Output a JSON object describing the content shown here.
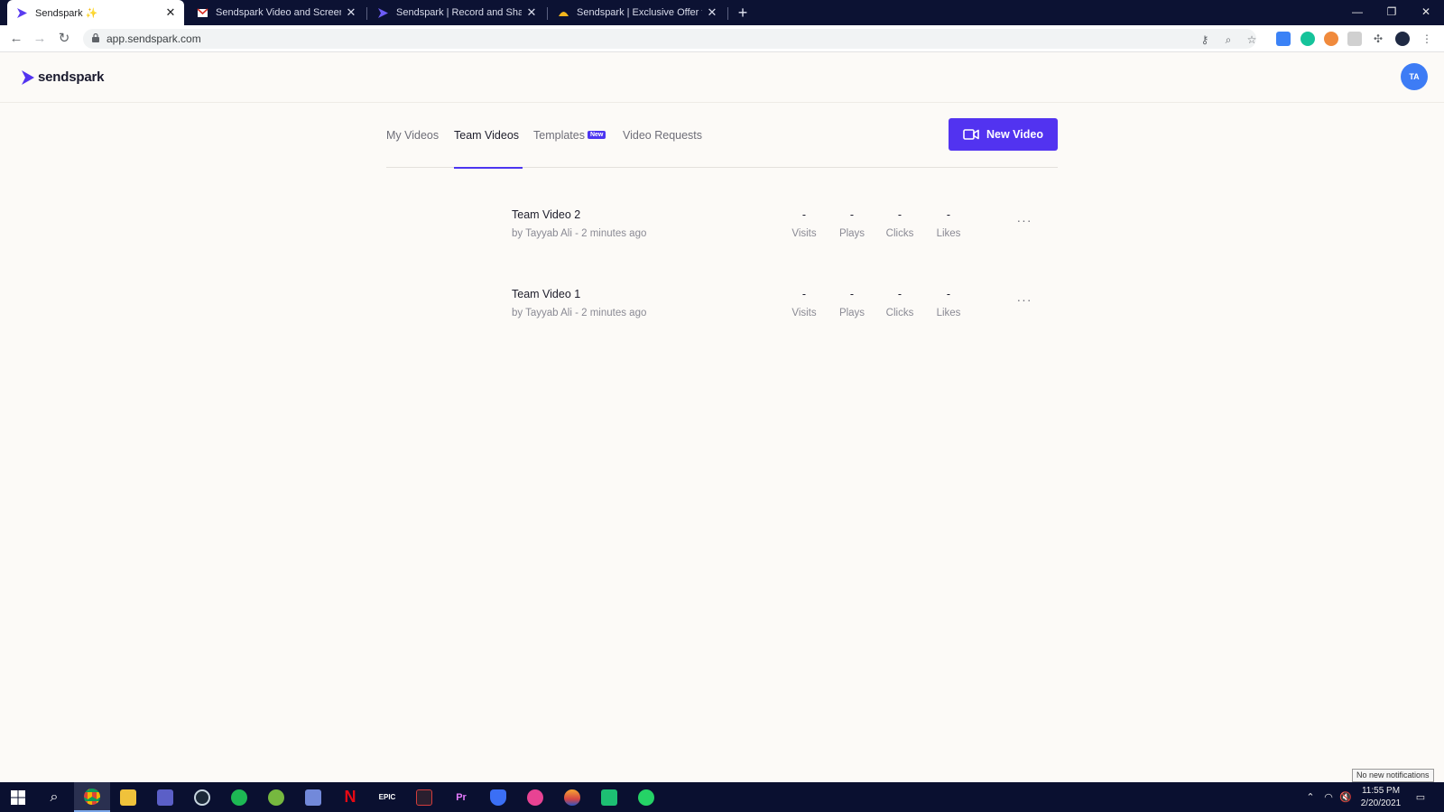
{
  "browser": {
    "tabs": [
      {
        "title": "Sendspark ✨",
        "favicon": "sendspark-icon",
        "active": true
      },
      {
        "title": "Sendspark Video and Screen Rec",
        "favicon": "gmail-icon",
        "active": false
      },
      {
        "title": "Sendspark | Record and Share Pe",
        "favicon": "sendspark-icon",
        "active": false
      },
      {
        "title": "Sendspark | Exclusive Offer from",
        "favicon": "taco-icon",
        "active": false
      }
    ],
    "url": "app.sendspark.com"
  },
  "app": {
    "logo_text": "sendspark",
    "avatar_initials": "TA",
    "nav": {
      "tabs": [
        {
          "label": "My Videos",
          "active": false
        },
        {
          "label": "Team Videos",
          "active": true
        },
        {
          "label": "Templates",
          "badge": "New",
          "active": false
        },
        {
          "label": "Video Requests",
          "active": false
        }
      ]
    },
    "new_video_label": "New Video",
    "accent_color": "#5233f0",
    "videos": [
      {
        "title": "Team Video 2",
        "subtitle": "by Tayyab Ali - 2 minutes ago",
        "stats": [
          {
            "value": "-",
            "label": "Visits"
          },
          {
            "value": "-",
            "label": "Plays"
          },
          {
            "value": "-",
            "label": "Clicks"
          },
          {
            "value": "-",
            "label": "Likes"
          }
        ],
        "more": "···"
      },
      {
        "title": "Team Video 1",
        "subtitle": "by Tayyab Ali - 2 minutes ago",
        "stats": [
          {
            "value": "-",
            "label": "Visits"
          },
          {
            "value": "-",
            "label": "Plays"
          },
          {
            "value": "-",
            "label": "Clicks"
          },
          {
            "value": "-",
            "label": "Likes"
          }
        ],
        "more": "···"
      }
    ]
  },
  "taskbar": {
    "notification_tip": "No new notifications",
    "time": "11:55 PM",
    "date": "2/20/2021"
  }
}
